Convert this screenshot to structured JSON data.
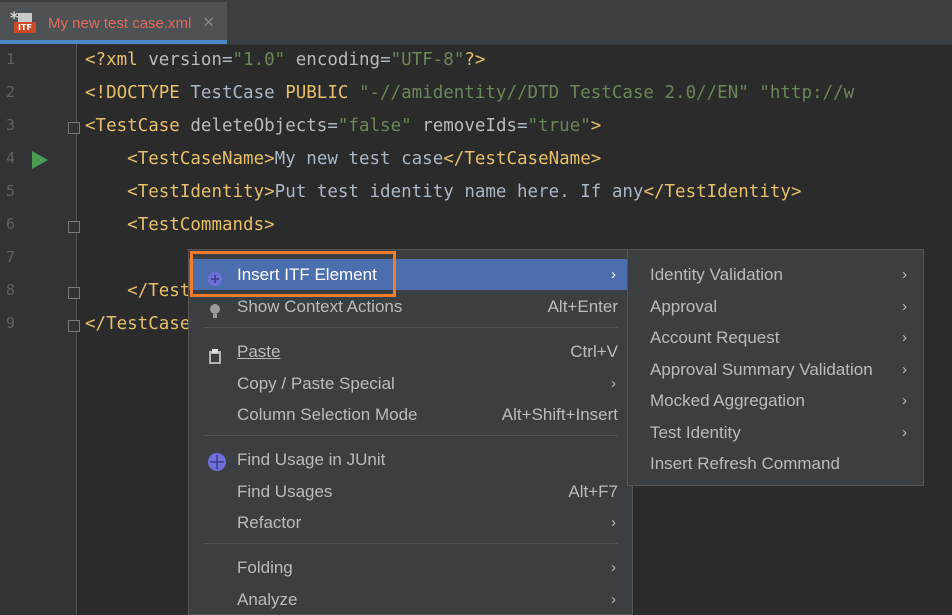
{
  "tab": {
    "modified_marker": "*",
    "file_badge": "ITF",
    "title": "My new test case.xml",
    "close": "×"
  },
  "gutter": {
    "line_numbers": [
      "1",
      "2",
      "3",
      "4",
      "5",
      "6",
      "7",
      "8",
      "9"
    ]
  },
  "code": {
    "line1": {
      "open": "<?xml ",
      "a1": "version",
      "eq1": "=",
      "v1": "\"1.0\"",
      "sp": " ",
      "a2": "encoding",
      "eq2": "=",
      "v2": "\"UTF-8\"",
      "close": "?>"
    },
    "line2": {
      "open": "<!DOCTYPE ",
      "name": "TestCase ",
      "kw": "PUBLIC ",
      "s1": "\"-//amidentity//DTD TestCase 2.0//EN\"",
      "sp": " ",
      "s2": "\"http://w"
    },
    "line3": {
      "open": "<TestCase",
      "sp1": " ",
      "a1": "deleteObjects",
      "eq1": "=",
      "v1": "\"false\"",
      "sp2": " ",
      "a2": "removeIds",
      "eq2": "=",
      "v2": "\"true\"",
      "close": ">"
    },
    "line4": {
      "indent": "    ",
      "open": "<TestCaseName>",
      "text": "My new test case",
      "close": "</TestCaseName>"
    },
    "line5": {
      "indent": "    ",
      "open": "<TestIdentity>",
      "text": "Put test identity name here. If any",
      "close": "</TestIdentity>"
    },
    "line6": {
      "indent": "    ",
      "open": "<TestCommands>"
    },
    "line8": {
      "indent": "    ",
      "open": "</TestCommands>"
    },
    "line9": {
      "open": "</TestCase>"
    }
  },
  "context_menu": {
    "items": [
      {
        "label": "Insert ITF Element",
        "shortcut": "",
        "submenu": true,
        "icon": "itf-element-icon"
      },
      {
        "label": "Show Context Actions",
        "shortcut": "Alt+Enter",
        "submenu": false,
        "icon": "lightbulb-icon"
      },
      {
        "label": "Paste",
        "shortcut": "Ctrl+V",
        "submenu": false,
        "icon": "clipboard-icon"
      },
      {
        "label": "Copy / Paste Special",
        "shortcut": "",
        "submenu": true
      },
      {
        "label": "Column Selection Mode",
        "shortcut": "Alt+Shift+Insert",
        "submenu": false
      },
      {
        "label": "Find Usage in JUnit",
        "shortcut": "",
        "submenu": false,
        "icon": "junit-icon"
      },
      {
        "label": "Find Usages",
        "shortcut": "Alt+F7",
        "submenu": false
      },
      {
        "label": "Refactor",
        "shortcut": "",
        "submenu": true
      },
      {
        "label": "Folding",
        "shortcut": "",
        "submenu": true
      },
      {
        "label": "Analyze",
        "shortcut": "",
        "submenu": true
      }
    ]
  },
  "submenu": {
    "items": [
      {
        "label": "Identity Validation",
        "submenu": true
      },
      {
        "label": "Approval",
        "submenu": true
      },
      {
        "label": "Account Request",
        "submenu": true
      },
      {
        "label": "Approval Summary Validation",
        "submenu": true
      },
      {
        "label": "Mocked Aggregation",
        "submenu": true
      },
      {
        "label": "Test Identity",
        "submenu": true
      },
      {
        "label": "Insert Refresh Command",
        "submenu": false
      }
    ]
  },
  "arrow_glyph": "›",
  "colors": {
    "selection": "#4b6eaf",
    "highlight_box": "#f07c2c",
    "tag": "#e8bf6a",
    "string": "#6a8759"
  }
}
